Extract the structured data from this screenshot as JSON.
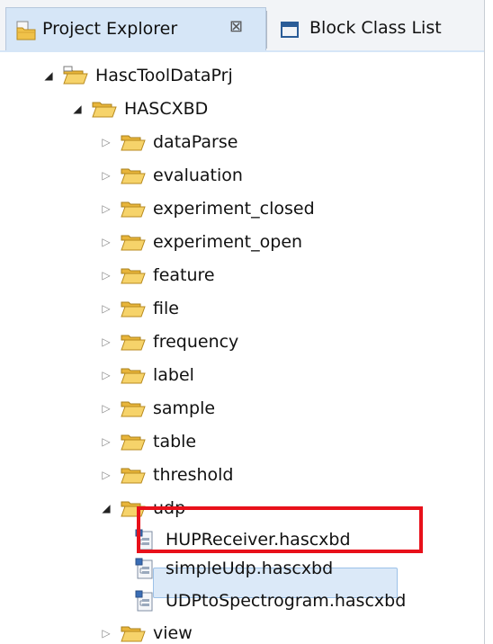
{
  "tabs": [
    {
      "label": "Project Explorer",
      "icon": "project-explorer-icon",
      "active": true,
      "close_glyph": "⊠"
    },
    {
      "label": "Block Class List",
      "icon": "window-icon",
      "active": false
    }
  ],
  "tree": [
    {
      "label": "HascToolDataPrj",
      "level": 0,
      "type": "project",
      "expanded": true
    },
    {
      "label": "HASCXBD",
      "level": 1,
      "type": "folder",
      "expanded": true
    },
    {
      "label": "dataParse",
      "level": 2,
      "type": "folder",
      "expanded": false
    },
    {
      "label": "evaluation",
      "level": 2,
      "type": "folder",
      "expanded": false
    },
    {
      "label": "experiment_closed",
      "level": 2,
      "type": "folder",
      "expanded": false
    },
    {
      "label": "experiment_open",
      "level": 2,
      "type": "folder",
      "expanded": false
    },
    {
      "label": "feature",
      "level": 2,
      "type": "folder",
      "expanded": false
    },
    {
      "label": "file",
      "level": 2,
      "type": "folder",
      "expanded": false
    },
    {
      "label": "frequency",
      "level": 2,
      "type": "folder",
      "expanded": false
    },
    {
      "label": "label",
      "level": 2,
      "type": "folder",
      "expanded": false
    },
    {
      "label": "sample",
      "level": 2,
      "type": "folder",
      "expanded": false
    },
    {
      "label": "table",
      "level": 2,
      "type": "folder",
      "expanded": false
    },
    {
      "label": "threshold",
      "level": 2,
      "type": "folder",
      "expanded": false
    },
    {
      "label": "udp",
      "level": 2,
      "type": "folder",
      "expanded": true
    },
    {
      "label": "HUPReceiver.hascxbd",
      "level": 3,
      "type": "file"
    },
    {
      "label": "simpleUdp.hascxbd",
      "level": 3,
      "type": "file",
      "selected": true
    },
    {
      "label": "UDPtoSpectrogram.hascxbd",
      "level": 3,
      "type": "file"
    },
    {
      "label": "view",
      "level": 2,
      "type": "folder",
      "expanded": false
    }
  ],
  "glyphs": {
    "expanded": "◢",
    "collapsed": "▷"
  },
  "colors": {
    "highlight": "#e8101a",
    "selection": "#dbe9f8",
    "folder": "#f0c24a",
    "active_tab": "#d6e6f7"
  }
}
